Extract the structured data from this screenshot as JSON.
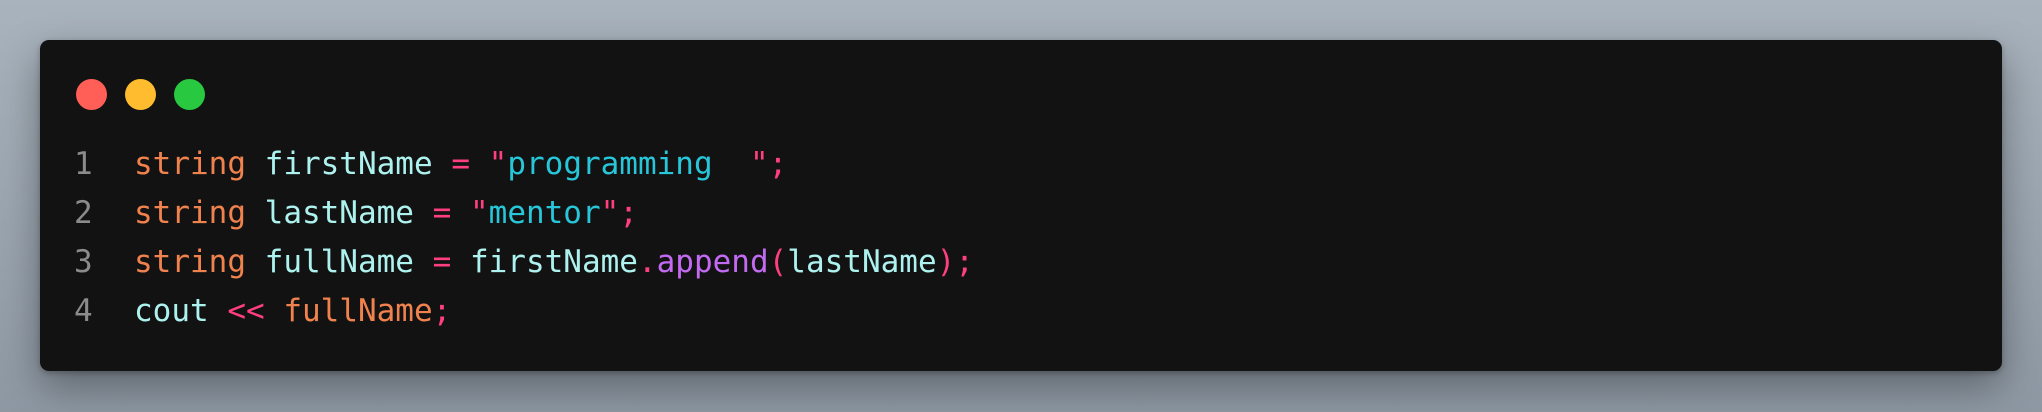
{
  "colors": {
    "background": "#9aa3ad",
    "editor_bg": "#121212",
    "line_number": "#8b8b8b",
    "keyword": "#f0824e",
    "identifier": "#aef2ef",
    "operator": "#ff3f7f",
    "string": "#27c6d9",
    "method": "#c26af2",
    "traffic_red": "#ff5f57",
    "traffic_yellow": "#febc2e",
    "traffic_green": "#28c840"
  },
  "window_controls": {
    "close_icon": "close-icon",
    "minimize_icon": "minimize-icon",
    "maximize_icon": "maximize-icon"
  },
  "code_lines": [
    {
      "number": "1",
      "tokens": [
        {
          "text": "string",
          "kind": "keyword"
        },
        {
          "text": " ",
          "kind": "space"
        },
        {
          "text": "firstName",
          "kind": "identifier"
        },
        {
          "text": " ",
          "kind": "space"
        },
        {
          "text": "=",
          "kind": "operator"
        },
        {
          "text": " ",
          "kind": "space"
        },
        {
          "text": "\"",
          "kind": "operator"
        },
        {
          "text": "programming  ",
          "kind": "string"
        },
        {
          "text": "\";",
          "kind": "operator"
        }
      ]
    },
    {
      "number": "2",
      "tokens": [
        {
          "text": "string",
          "kind": "keyword"
        },
        {
          "text": " ",
          "kind": "space"
        },
        {
          "text": "lastName",
          "kind": "identifier"
        },
        {
          "text": " ",
          "kind": "space"
        },
        {
          "text": "=",
          "kind": "operator"
        },
        {
          "text": " ",
          "kind": "space"
        },
        {
          "text": "\"",
          "kind": "operator"
        },
        {
          "text": "mentor",
          "kind": "string"
        },
        {
          "text": "\";",
          "kind": "operator"
        }
      ]
    },
    {
      "number": "3",
      "tokens": [
        {
          "text": "string",
          "kind": "keyword"
        },
        {
          "text": " ",
          "kind": "space"
        },
        {
          "text": "fullName",
          "kind": "identifier"
        },
        {
          "text": " ",
          "kind": "space"
        },
        {
          "text": "=",
          "kind": "operator"
        },
        {
          "text": " ",
          "kind": "space"
        },
        {
          "text": "firstName",
          "kind": "identifier"
        },
        {
          "text": ".",
          "kind": "operator"
        },
        {
          "text": "append",
          "kind": "method"
        },
        {
          "text": "(",
          "kind": "operator"
        },
        {
          "text": "lastName",
          "kind": "identifier"
        },
        {
          "text": ");",
          "kind": "operator"
        }
      ]
    },
    {
      "number": "4",
      "tokens": [
        {
          "text": "cout",
          "kind": "identifier"
        },
        {
          "text": " ",
          "kind": "space"
        },
        {
          "text": "<<",
          "kind": "operator"
        },
        {
          "text": " ",
          "kind": "space"
        },
        {
          "text": "fullName",
          "kind": "keyword"
        },
        {
          "text": ";",
          "kind": "operator"
        }
      ]
    }
  ]
}
